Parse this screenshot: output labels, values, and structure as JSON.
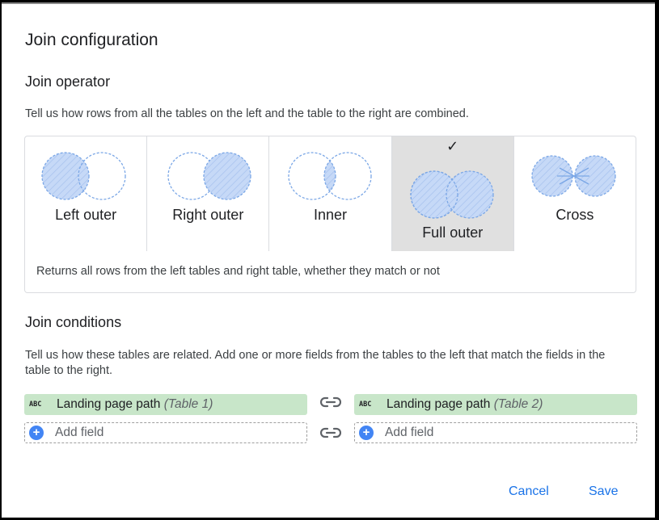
{
  "dialog": {
    "title": "Join configuration",
    "operator_section": {
      "heading": "Join operator",
      "description": "Tell us how rows from all the tables on the left and the table to the right are combined.",
      "options": [
        {
          "label": "Left outer",
          "icon": "venn-left-outer-icon",
          "selected": false
        },
        {
          "label": "Right outer",
          "icon": "venn-right-outer-icon",
          "selected": false
        },
        {
          "label": "Inner",
          "icon": "venn-inner-icon",
          "selected": false
        },
        {
          "label": "Full outer",
          "icon": "venn-full-outer-icon",
          "selected": true
        },
        {
          "label": "Cross",
          "icon": "venn-cross-icon",
          "selected": false
        }
      ],
      "selected_check": "✓",
      "selected_description": "Returns all rows from the left tables and right table, whether they match or not"
    },
    "conditions_section": {
      "heading": "Join conditions",
      "description": "Tell us how these tables are related. Add one or more fields from the tables to the left that match the fields in the table to the right.",
      "left": {
        "type_badge": "ABC",
        "field_name": "Landing page path",
        "table": "(Table 1)",
        "add_field": "Add field"
      },
      "right": {
        "type_badge": "ABC",
        "field_name": "Landing page path",
        "table": "(Table 2)",
        "add_field": "Add field"
      },
      "add_icon": "+"
    },
    "buttons": {
      "cancel": "Cancel",
      "save": "Save"
    },
    "colors": {
      "accent": "#1a73e8",
      "field_fill": "#c8e6c9",
      "venn_fill": "#c6d9f7",
      "venn_stroke": "#7ba7e6",
      "selected_bg": "#e0e0e0"
    }
  }
}
